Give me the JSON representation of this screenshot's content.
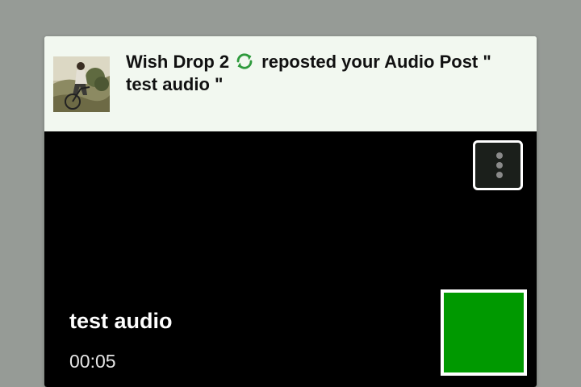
{
  "notification": {
    "user_name": "Wish Drop 2",
    "action_text": "reposted your Audio Post \"",
    "post_title_quoted": "test audio \"",
    "repost_icon": "repost-icon",
    "avatar_icon": "user-avatar-photo"
  },
  "player": {
    "title": "test audio",
    "duration": "00:05",
    "menu_icon": "more-vertical-icon",
    "thumbnail_color": "#009900"
  },
  "colors": {
    "page_background": "#969b96",
    "card_background": "#f2f8f0",
    "player_background": "#000000",
    "accent_green": "#2e9a3c"
  }
}
